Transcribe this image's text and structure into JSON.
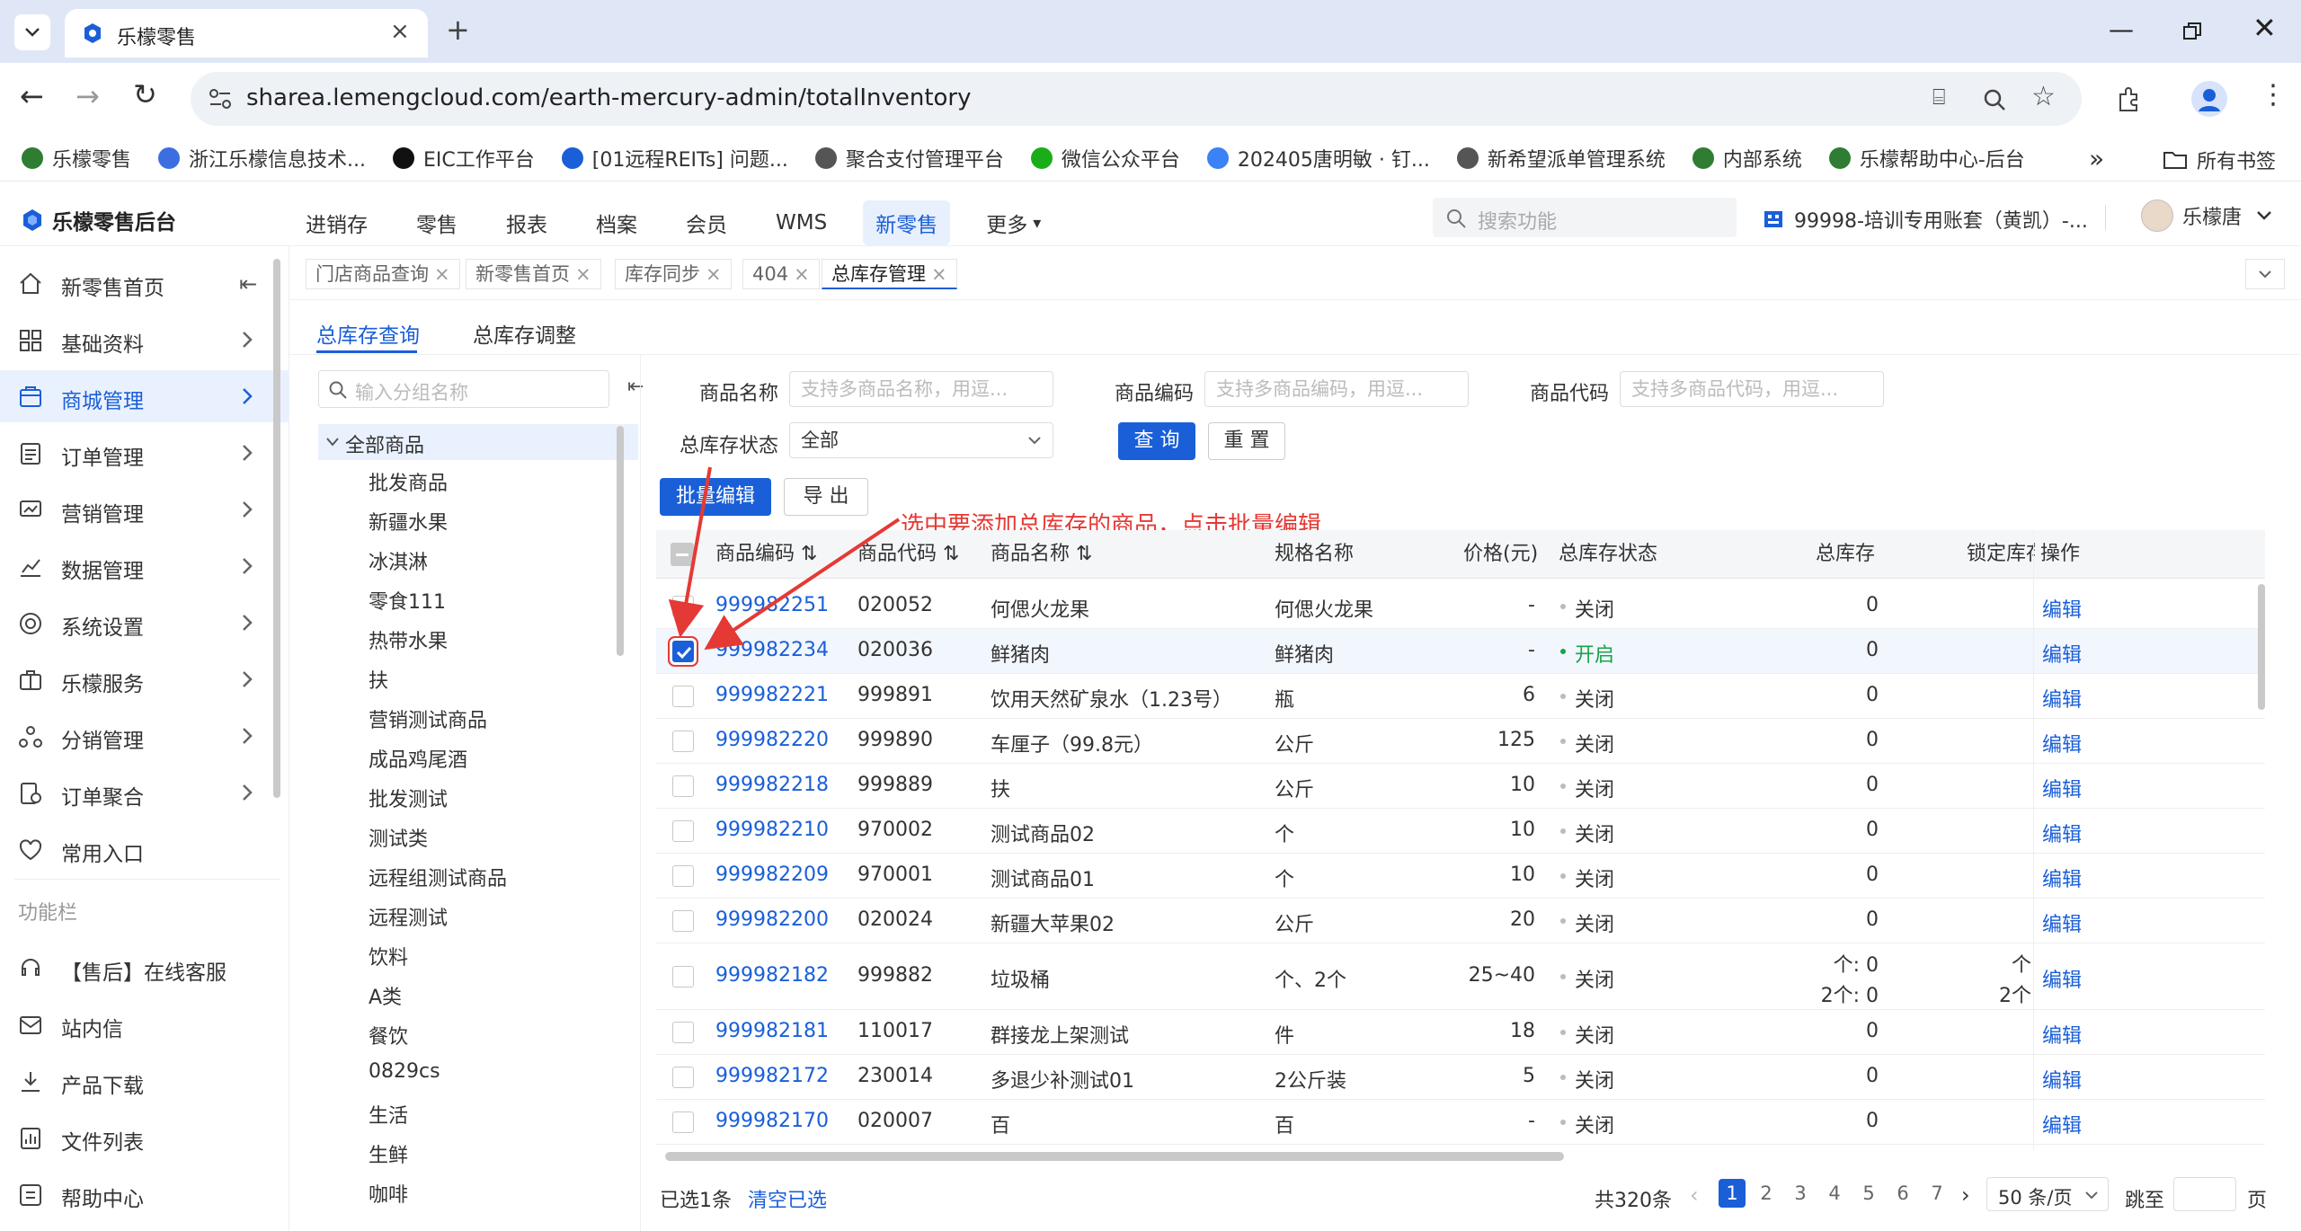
{
  "browser": {
    "tab_title": "乐檬零售",
    "url": "sharea.lemengcloud.com/earth-mercury-admin/totalInventory",
    "bookmarks": [
      {
        "label": "乐檬零售",
        "color": "#2e7d32"
      },
      {
        "label": "浙江乐檬信息技术...",
        "color": "#3b6fe0"
      },
      {
        "label": "EIC工作平台",
        "color": "#111111"
      },
      {
        "label": "[01远程REITs] 问题...",
        "color": "#1a5fd8"
      },
      {
        "label": "聚合支付管理平台",
        "color": "#555555"
      },
      {
        "label": "微信公众平台",
        "color": "#1aad19"
      },
      {
        "label": "202405唐明敏 · 钉...",
        "color": "#3b82f6"
      },
      {
        "label": "新希望派单管理系统",
        "color": "#555555"
      },
      {
        "label": "内部系统",
        "color": "#2e7d32"
      },
      {
        "label": "乐檬帮助中心-后台",
        "color": "#2e7d32"
      }
    ],
    "all_bookmarks": "所有书签"
  },
  "app": {
    "logo_text": "乐檬零售后台",
    "nav": [
      "进销存",
      "零售",
      "报表",
      "档案",
      "会员",
      "WMS",
      "新零售",
      "更多"
    ],
    "nav_active": "新零售",
    "search_placeholder": "搜索功能",
    "account": "99998-培训专用账套（黄凯）-...",
    "user": "乐檬唐"
  },
  "sidebar": {
    "items": [
      "新零售首页",
      "基础资料",
      "商城管理",
      "订单管理",
      "营销管理",
      "数据管理",
      "系统设置",
      "乐檬服务",
      "分销管理",
      "订单聚合",
      "常用入口"
    ],
    "section": "功能栏",
    "tools": [
      "【售后】在线客服",
      "站内信",
      "产品下载",
      "文件列表",
      "帮助中心"
    ]
  },
  "tags": [
    "门店商品查询",
    "新零售首页",
    "库存同步",
    "404",
    "总库存管理"
  ],
  "subtabs": [
    "总库存查询",
    "总库存调整"
  ],
  "tree": {
    "search_placeholder": "输入分组名称",
    "root": "全部商品",
    "children": [
      "批发商品",
      "新疆水果",
      "冰淇淋",
      "零食111",
      "热带水果",
      "扶",
      "营销测试商品",
      "成品鸡尾酒",
      "批发测试",
      "测试类",
      "远程组测试商品",
      "远程测试",
      "饮料",
      "A类",
      "餐饮",
      "0829cs",
      "生活",
      "生鲜",
      "咖啡"
    ]
  },
  "filters": {
    "name_label": "商品名称",
    "name_placeholder": "支持多商品名称，用逗...",
    "code_label": "商品编码",
    "code_placeholder": "支持多商品编码，用逗...",
    "pcode_label": "商品代码",
    "pcode_placeholder": "支持多商品代码，用逗...",
    "status_label": "总库存状态",
    "status_value": "全部",
    "query": "查 询",
    "reset": "重 置"
  },
  "actions": {
    "batch_edit": "批量编辑",
    "export": "导 出"
  },
  "annotation": "选中要添加总库存的商品，点击批量编辑",
  "table": {
    "headers": [
      "商品编码",
      "商品代码",
      "商品名称",
      "规格名称",
      "价格(元)",
      "总库存状态",
      "总库存",
      "锁定库存",
      "操作"
    ],
    "rows": [
      {
        "code": "999982251",
        "pcode": "020052",
        "name": "何偲火龙果",
        "spec": "何偲火龙果",
        "price": "-",
        "status": "关闭",
        "stock": "0",
        "locked": "",
        "op": "编辑"
      },
      {
        "code": "999982234",
        "pcode": "020036",
        "name": "鲜猪肉",
        "spec": "鲜猪肉",
        "price": "-",
        "status": "开启",
        "stock": "0",
        "locked": "",
        "op": "编辑"
      },
      {
        "code": "999982221",
        "pcode": "999891",
        "name": "饮用天然矿泉水（1.23号）",
        "spec": "瓶",
        "price": "6",
        "status": "关闭",
        "stock": "0",
        "locked": "",
        "op": "编辑"
      },
      {
        "code": "999982220",
        "pcode": "999890",
        "name": "车厘子（99.8元）",
        "spec": "公斤",
        "price": "125",
        "status": "关闭",
        "stock": "0",
        "locked": "",
        "op": "编辑"
      },
      {
        "code": "999982218",
        "pcode": "999889",
        "name": "扶",
        "spec": "公斤",
        "price": "10",
        "status": "关闭",
        "stock": "0",
        "locked": "",
        "op": "编辑"
      },
      {
        "code": "999982210",
        "pcode": "970002",
        "name": "测试商品02",
        "spec": "个",
        "price": "10",
        "status": "关闭",
        "stock": "0",
        "locked": "",
        "op": "编辑"
      },
      {
        "code": "999982209",
        "pcode": "970001",
        "name": "测试商品01",
        "spec": "个",
        "price": "10",
        "status": "关闭",
        "stock": "0",
        "locked": "",
        "op": "编辑"
      },
      {
        "code": "999982200",
        "pcode": "020024",
        "name": "新疆大苹果02",
        "spec": "公斤",
        "price": "20",
        "status": "关闭",
        "stock": "0",
        "locked": "",
        "op": "编辑"
      },
      {
        "code": "999982182",
        "pcode": "999882",
        "name": "垃圾桶",
        "spec": "个、2个",
        "price": "25~40",
        "status": "关闭",
        "stock": "个: 0",
        "stock2": "2个: 0",
        "locked": "个",
        "locked2": "2个",
        "op": "编辑"
      },
      {
        "code": "999982181",
        "pcode": "110017",
        "name": "群接龙上架测试",
        "spec": "件",
        "price": "18",
        "status": "关闭",
        "stock": "0",
        "locked": "",
        "op": "编辑"
      },
      {
        "code": "999982172",
        "pcode": "230014",
        "name": "多退少补测试01",
        "spec": "2公斤装",
        "price": "5",
        "status": "关闭",
        "stock": "0",
        "locked": "",
        "op": "编辑"
      },
      {
        "code": "999982170",
        "pcode": "020007",
        "name": "百",
        "spec": "百",
        "price": "-",
        "status": "关闭",
        "stock": "0",
        "locked": "",
        "op": "编辑"
      }
    ]
  },
  "footer": {
    "selected": "已选1条",
    "clear": "清空已选",
    "total": "共320条",
    "pages": [
      "1",
      "2",
      "3",
      "4",
      "5",
      "6",
      "7"
    ],
    "page_size": "50 条/页",
    "jump_label": "跳至",
    "page_unit": "页"
  },
  "colors": {
    "primary": "#1a5fd8",
    "annotation": "#e53935",
    "status_on": "#1aa34a"
  }
}
